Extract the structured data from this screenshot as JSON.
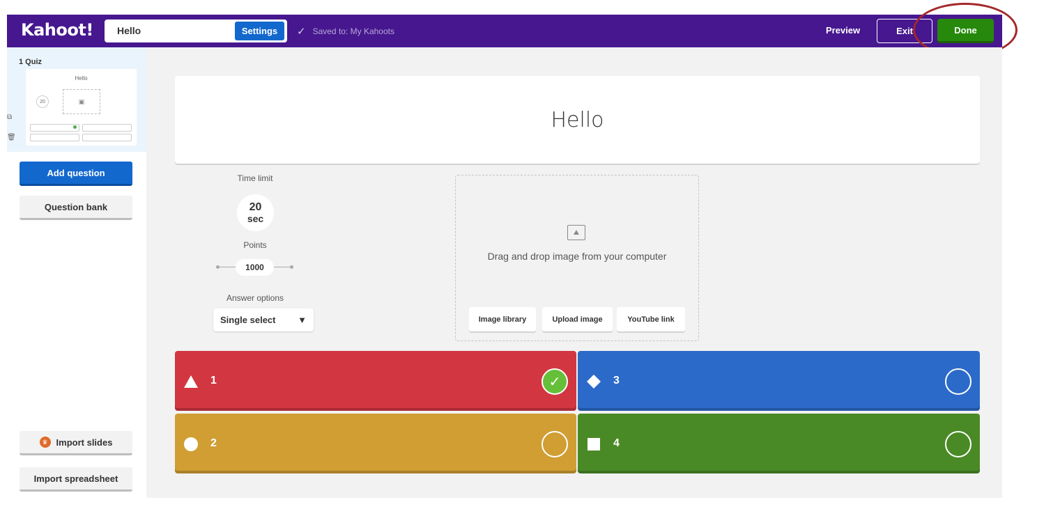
{
  "topbar": {
    "logo": "Kahoot!",
    "title_value": "Hello",
    "settings_label": "Settings",
    "saved_text": "Saved to: My Kahoots",
    "preview_label": "Preview",
    "exit_label": "Exit",
    "done_label": "Done",
    "bg_color": "#46178f"
  },
  "sidebar": {
    "slide": {
      "label": "1 Quiz",
      "thumb_title": "Hello",
      "thumb_time": "20"
    },
    "add_question": "Add question",
    "question_bank": "Question bank",
    "import_slides": "Import slides",
    "import_spreadsheet": "Import spreadsheet"
  },
  "question": {
    "text": "Hello"
  },
  "settings": {
    "time_limit_label": "Time limit",
    "time_value": "20",
    "time_unit": "sec",
    "points_label": "Points",
    "points_value": "1000",
    "answer_options_label": "Answer options",
    "answer_option_value": "Single select"
  },
  "media": {
    "drag_text": "Drag and drop image from your computer",
    "image_library": "Image library",
    "upload_image": "Upload image",
    "youtube_link": "YouTube link"
  },
  "answers": [
    {
      "text": "1",
      "shape": "triangle-icon",
      "color": "#d13641",
      "correct": true
    },
    {
      "text": "2",
      "shape": "circle-icon",
      "color": "#d09e33",
      "correct": false
    },
    {
      "text": "3",
      "shape": "diamond-icon",
      "color": "#2c6ac9",
      "correct": false
    },
    {
      "text": "4",
      "shape": "square-icon",
      "color": "#4a8a26",
      "correct": false
    }
  ]
}
